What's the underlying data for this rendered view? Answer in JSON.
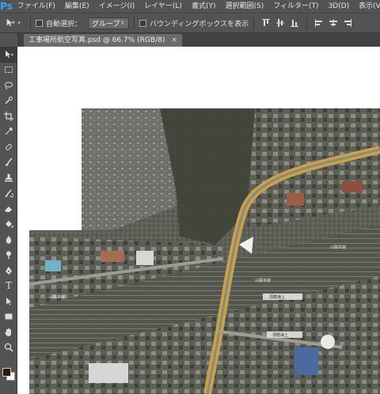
{
  "menubar": {
    "logo": "Ps",
    "items": [
      "ファイル(F)",
      "編集(E)",
      "イメージ(I)",
      "レイヤー(L)",
      "書式(Y)",
      "選択範囲(S)",
      "フィルター(T)",
      "3D(D)",
      "表示(V)"
    ]
  },
  "options": {
    "tool_icon": "move-tool-icon",
    "auto_select_label": "自動選択：",
    "auto_select_value": "グループ",
    "bbox_label": "バウンディングボックスを表示",
    "align_icons": [
      "align-top-icon",
      "align-vcenter-icon",
      "align-bottom-icon",
      "align-left-icon",
      "align-hcenter-icon",
      "align-right-icon"
    ]
  },
  "document": {
    "tab_title": "工事場所航空写真.psd @ 66.7% (RGB/8)",
    "close_glyph": "×"
  },
  "tools": [
    "move-tool-icon",
    "marquee-tool-icon",
    "lasso-tool-icon",
    "quick-select-tool-icon",
    "crop-tool-icon",
    "eyedropper-tool-icon",
    "spot-healing-tool-icon",
    "brush-tool-icon",
    "clone-stamp-tool-icon",
    "history-brush-tool-icon",
    "eraser-tool-icon",
    "paint-bucket-tool-icon",
    "blur-tool-icon",
    "dodge-tool-icon",
    "pen-tool-icon",
    "type-tool-icon",
    "path-select-tool-icon",
    "rectangle-tool-icon",
    "hand-tool-icon",
    "zoom-tool-icon"
  ],
  "colors": {
    "foreground": "#2a1b10",
    "background": "#ffffff",
    "accent": "#31a8ff"
  },
  "map_labels": {
    "rail1": "山陽本線",
    "rail2": "山陽本線",
    "rail3": "山陽本線",
    "place1": "須磨海上",
    "place2": "須磨海上"
  }
}
